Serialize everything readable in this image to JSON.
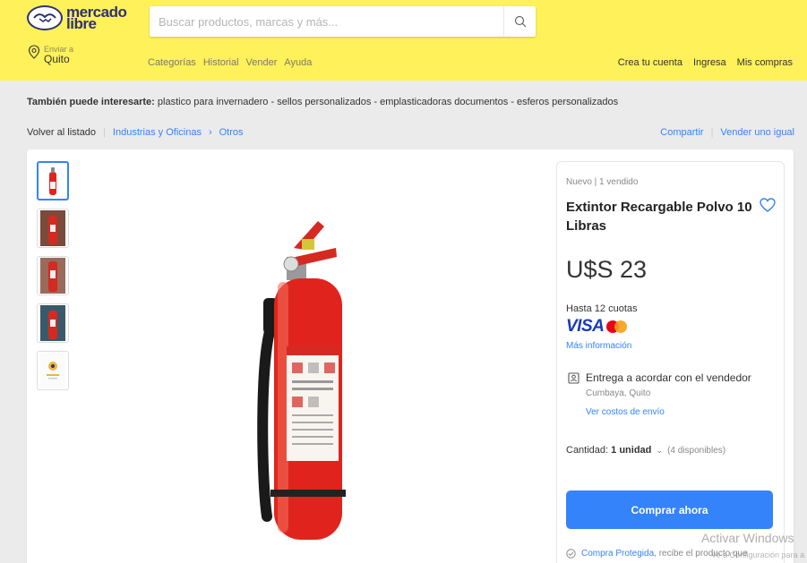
{
  "header": {
    "logo": {
      "line1": "mercado",
      "line2": "libre"
    },
    "search": {
      "placeholder": "Buscar productos, marcas y más..."
    },
    "location": {
      "label": "Enviar a",
      "city": "Quito"
    },
    "nav": [
      "Categorías",
      "Historial",
      "Vender",
      "Ayuda"
    ],
    "user_links": [
      "Crea tu cuenta",
      "Ingresa",
      "Mis compras"
    ],
    "colors": {
      "bg": "#fff159",
      "brand": "#2d3277"
    }
  },
  "suggestions": {
    "label": "También puede interesarte:",
    "items": "plastico para invernadero - sellos personalizados - emplasticadoras documentos - esferos personalizados"
  },
  "breadcrumb": {
    "back": "Volver al listado",
    "categories": [
      "Industrias y Oficinas",
      "Otros"
    ],
    "separator": "›"
  },
  "actions": {
    "share": "Compartir",
    "sell": "Vender uno igual"
  },
  "product": {
    "condition": "Nuevo | 1 vendido",
    "title": "Extintor Recargable Polvo 10 Libras",
    "price": "U$S 23",
    "installments": "Hasta 12 cuotas",
    "card_brand": "VISA",
    "more_info": "Más información",
    "delivery": "Entrega a acordar con el vendedor",
    "delivery_location": "Cumbaya, Quito",
    "shipping_link": "Ver costos de envío",
    "quantity_label": "Cantidad:",
    "quantity_value": "1 unidad",
    "available": "(4 disponibles)",
    "buy_button": "Comprar ahora",
    "protected_link": "Compra Protegida",
    "protected_text": ", recibe el producto que",
    "accent": "#3483fa"
  },
  "thumbnails": [
    "extinguisher-front",
    "extinguisher-photo-1",
    "extinguisher-photo-2",
    "extinguisher-photo-3",
    "document-logo"
  ],
  "watermark": {
    "title": "Activar Windows",
    "sub": "Ve a Configuración para a"
  }
}
